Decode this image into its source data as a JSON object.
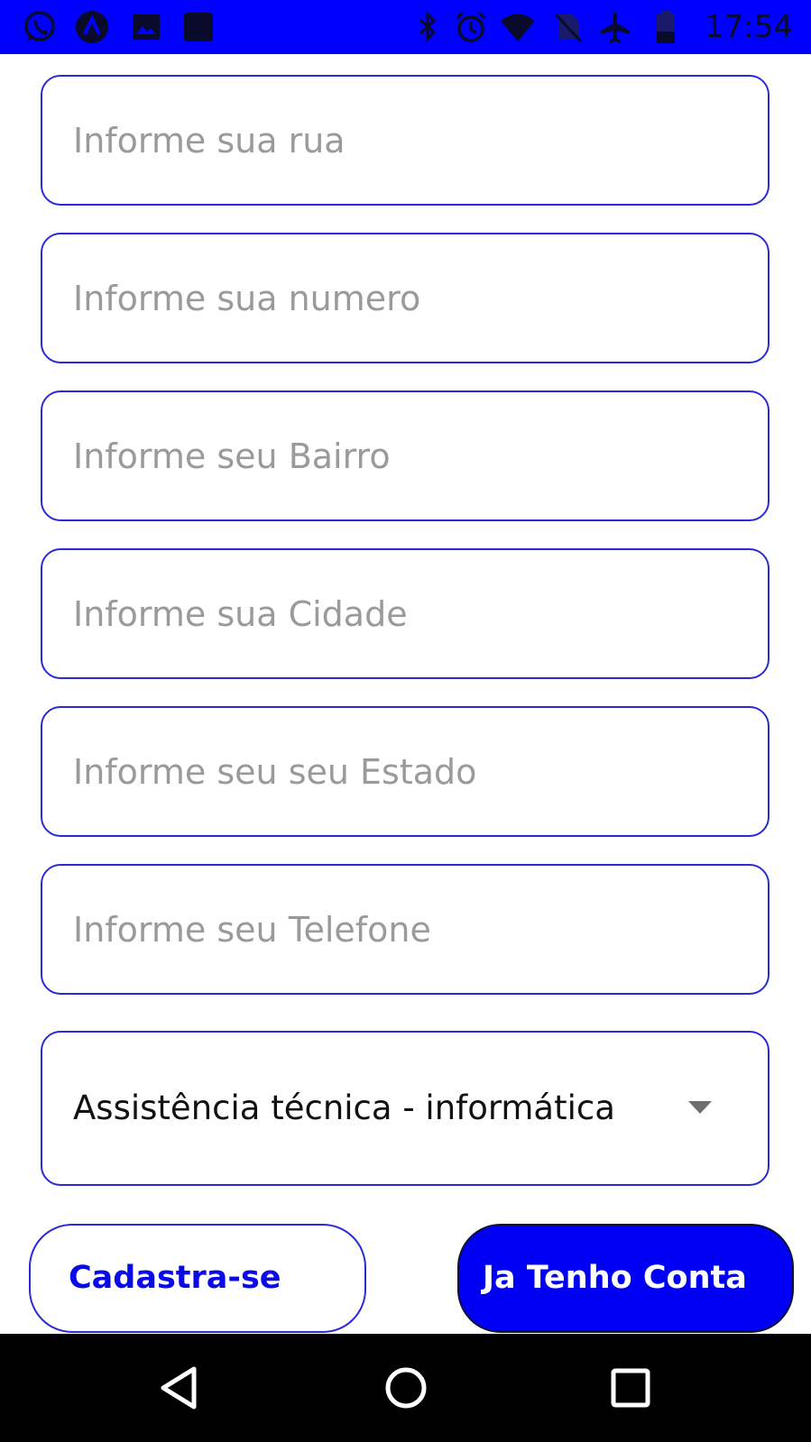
{
  "status_bar": {
    "time": "17:54",
    "left_icons": [
      "whatsapp-icon",
      "app-a-icon",
      "gallery-icon",
      "square-app-icon"
    ],
    "right_icons": [
      "bluetooth-icon",
      "alarm-icon",
      "wifi-icon",
      "no-sim-icon",
      "airplane-icon",
      "battery-icon"
    ],
    "color": "#0000ff"
  },
  "form": {
    "rua_placeholder": "Informe sua rua",
    "numero_placeholder": "Informe sua numero",
    "bairro_placeholder": "Informe seu Bairro",
    "cidade_placeholder": "Informe sua Cidade",
    "estado_placeholder": "Informe seu seu Estado",
    "telefone_placeholder": "Informe seu Telefone",
    "categoria_selected": "Assistência técnica - informática"
  },
  "buttons": {
    "register_label": "Cadastra-se",
    "login_label": "Ja Tenho Conta"
  },
  "nav_bar": {
    "icons": [
      "back-icon",
      "home-icon",
      "recents-icon"
    ]
  },
  "colors": {
    "accent": "#0000ff",
    "field_border": "#2b2bd6",
    "placeholder": "#9a9a9a"
  }
}
